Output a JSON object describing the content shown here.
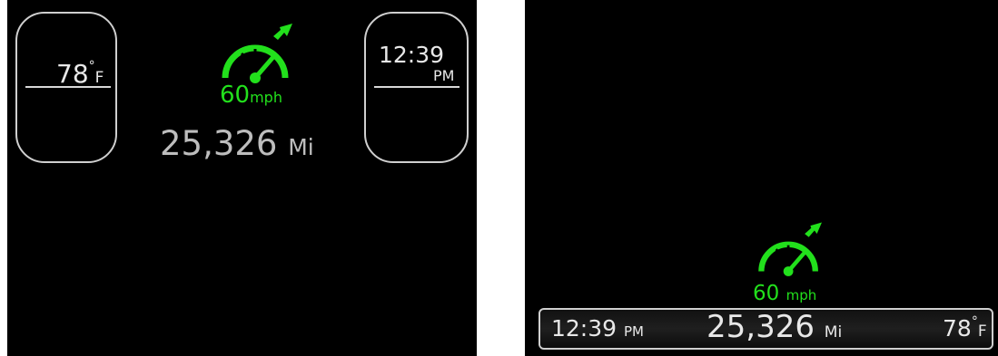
{
  "colors": {
    "accent_green": "#22e01c",
    "text": "#e8e8e8",
    "odometer_text": "#bdbdbd",
    "background": "#000000"
  },
  "layout_a": {
    "temperature": {
      "value": "78",
      "degree": "°",
      "unit": "F"
    },
    "clock": {
      "time": "12:39",
      "period": "PM"
    },
    "speedometer": {
      "icon": "cruise-speedometer-icon",
      "speed": "60",
      "unit": "mph"
    },
    "odometer": {
      "value": "25,326",
      "unit": "Mi"
    }
  },
  "layout_b": {
    "speedometer": {
      "icon": "cruise-speedometer-icon",
      "speed": "60",
      "unit": "mph"
    },
    "bottom_bar": {
      "time": "12:39",
      "period": "PM",
      "odometer": "25,326",
      "odometer_unit": "Mi",
      "temperature": "78",
      "degree": "°",
      "temp_unit": "F"
    }
  }
}
